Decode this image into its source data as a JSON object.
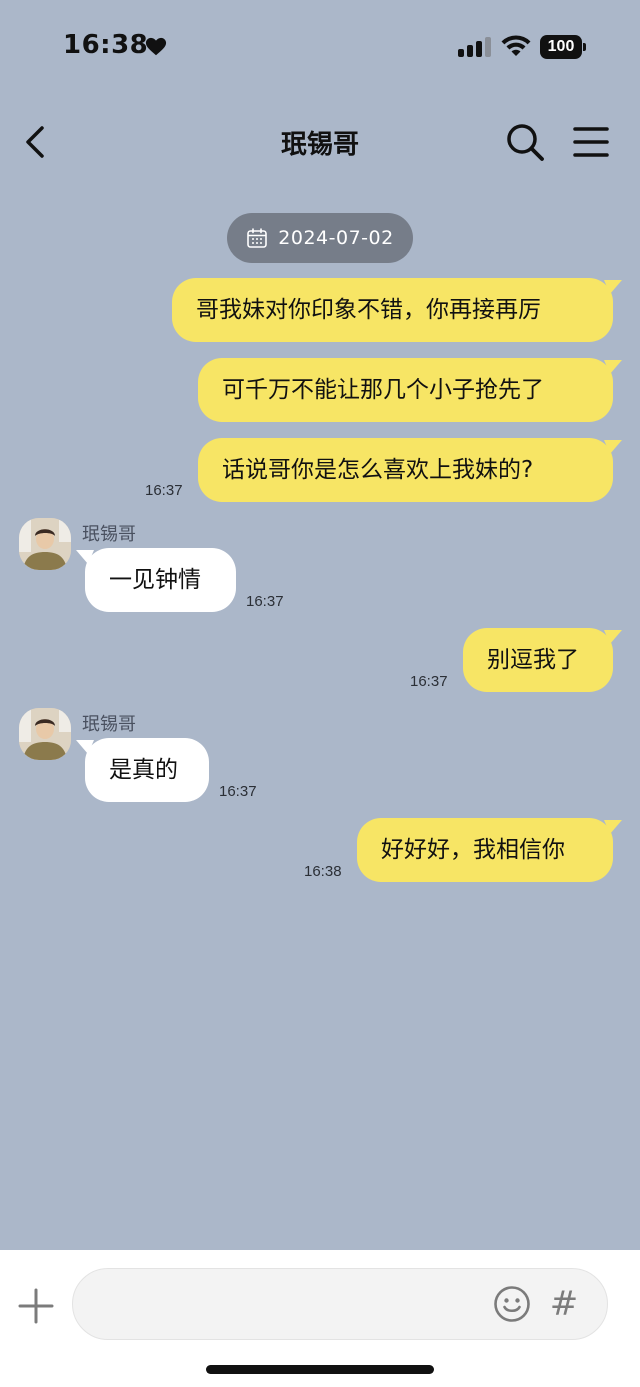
{
  "status_bar": {
    "time": "16:38",
    "battery": "100"
  },
  "header": {
    "title": "珉锡哥"
  },
  "date_divider": "2024-07-02",
  "messages": [
    {
      "side": "out",
      "text": "哥我妹对你印象不错，你再接再厉",
      "time": ""
    },
    {
      "side": "out",
      "text": "可千万不能让那几个小子抢先了",
      "time": ""
    },
    {
      "side": "out",
      "text": "话说哥你是怎么喜欢上我妹的?",
      "time": "16:37"
    },
    {
      "side": "in",
      "sender": "珉锡哥",
      "text": "一见钟情",
      "time": "16:37"
    },
    {
      "side": "out",
      "text": "别逗我了",
      "time": "16:37"
    },
    {
      "side": "in",
      "sender": "珉锡哥",
      "text": "是真的",
      "time": "16:37"
    },
    {
      "side": "out",
      "text": "好好好，我相信你",
      "time": "16:38"
    }
  ],
  "composer": {
    "placeholder": "",
    "hash_label": "#"
  },
  "colors": {
    "background": "#abb7c9",
    "outgoing_bubble": "#f7e565",
    "incoming_bubble": "#ffffff",
    "date_pill": "#767d89"
  },
  "icons": [
    "heart-icon",
    "signal-icon",
    "wifi-icon",
    "battery-icon",
    "back-arrow-icon",
    "search-icon",
    "menu-icon",
    "calendar-icon",
    "plus-icon",
    "emoji-icon",
    "hash-icon"
  ]
}
